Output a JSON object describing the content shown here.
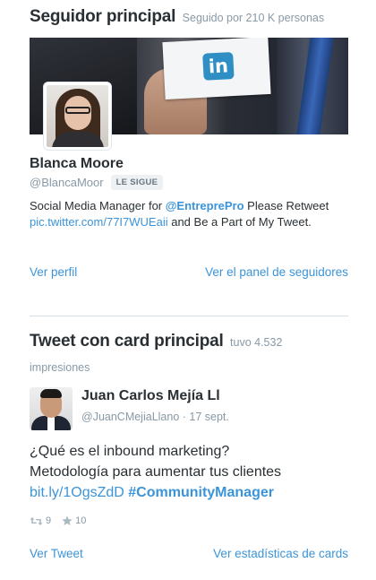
{
  "featured_follower": {
    "title": "Seguidor principal",
    "subtitle": "Seguido por 210 K personas",
    "name": "Blanca Moore",
    "handle": "@BlancaMoor",
    "follows_badge": "LE SIGUE",
    "bio": {
      "part1": "Social Media Manager for ",
      "mention": "@EntreprePro",
      "part2": " Please Retweet ",
      "link": "pic.twitter.com/77I7WUEaii",
      "part3": " and Be a Part of My Tweet."
    },
    "links": {
      "view_profile": "Ver perfil",
      "view_dashboard": "Ver el panel de seguidores"
    }
  },
  "featured_card_tweet": {
    "title": "Tweet con card principal",
    "subtitle": "tuvo 4.532",
    "impressions_label": "impresiones",
    "author_name": "Juan Carlos Mejía Ll",
    "author_handle": "@JuanCMejiaLlano",
    "separator": " · ",
    "date": "17 sept.",
    "text": {
      "line1": "¿Qué es el inbound marketing?",
      "line2": "Metodología para aumentar tus clientes",
      "link": "bit.ly/1OgsZdD",
      "space": " ",
      "hashtag": "#CommunityManager"
    },
    "retweets": "9",
    "favorites": "10",
    "links": {
      "view_tweet": "Ver Tweet",
      "view_card_stats": "Ver estadísticas de cards"
    }
  },
  "icons": {
    "retweet": "retweet-icon",
    "favorite": "star-icon",
    "banner_logo": "linkedin-logo"
  },
  "colors": {
    "link": "#3b94d9",
    "muted": "#8899a6",
    "text": "#292f33"
  }
}
